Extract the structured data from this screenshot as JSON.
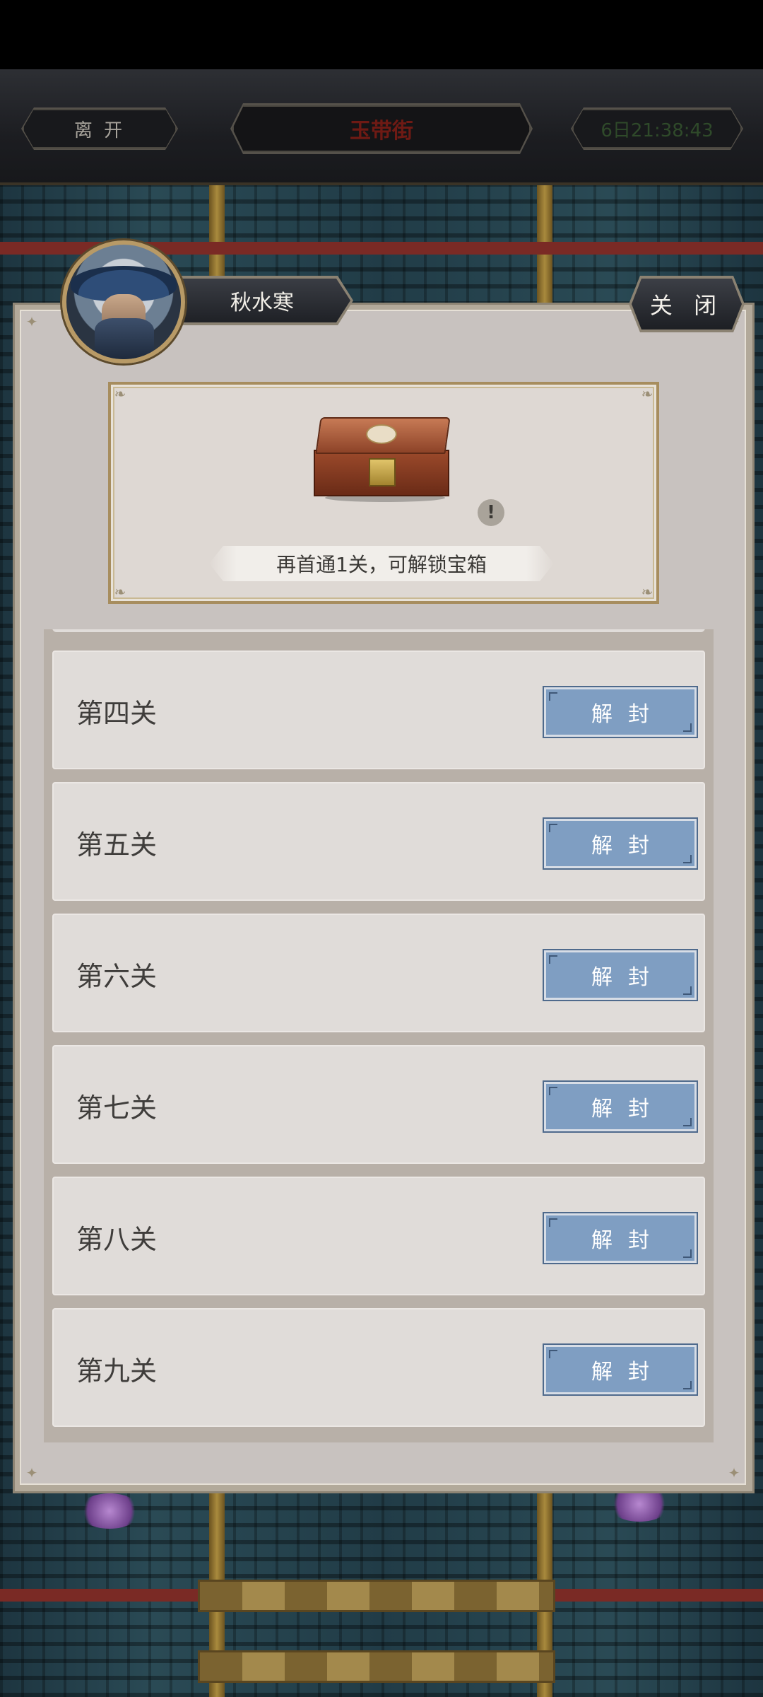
{
  "top_bar": {
    "leave_label": "离 开",
    "location_label": "玉带街",
    "timer_label": "6日21:38:43"
  },
  "dialog": {
    "character_name": "秋水寒",
    "close_label": "关 闭",
    "reward": {
      "icon": "treasure-chest-icon",
      "info_icon": "!",
      "unlock_text": "再首通1关，可解锁宝箱"
    },
    "levels": [
      {
        "name": "第四关",
        "button": "解封"
      },
      {
        "name": "第五关",
        "button": "解封"
      },
      {
        "name": "第六关",
        "button": "解封"
      },
      {
        "name": "第七关",
        "button": "解封"
      },
      {
        "name": "第八关",
        "button": "解封"
      },
      {
        "name": "第九关",
        "button": "解封"
      }
    ]
  },
  "colors": {
    "location_text": "#6e1a14",
    "timer_text": "#2f4a2a",
    "unseal_button": "#7f9ec2",
    "panel_bg": "#c8c2bf"
  }
}
